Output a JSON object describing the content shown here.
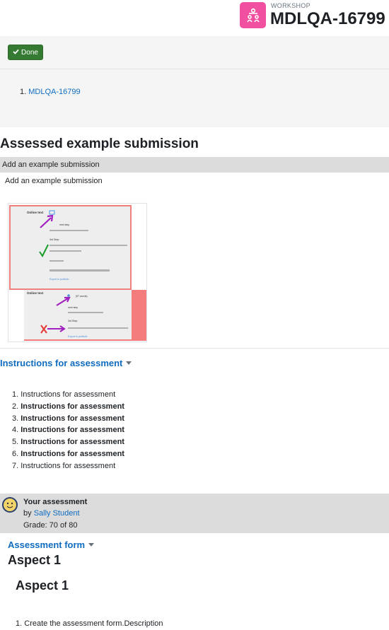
{
  "header": {
    "kicker": "WORKSHOP",
    "title": "MDLQA-16799",
    "icon": "workshop-people-icon",
    "icon_color": "#f14fa0"
  },
  "done_panel": {
    "done_label": "Done",
    "list_items": [
      {
        "num": "1.",
        "link": "MDLQA-16799"
      }
    ]
  },
  "assessed": {
    "title": "Assessed example submission",
    "bar_label": "Add an example submission",
    "line_label": "Add an example submission",
    "thumbnail": {
      "panel1_heading": "Online text",
      "panel1_lines": [
        "next step",
        "3rd Step:",
        "Export to portfolio"
      ],
      "panel2_heading": "Online text",
      "panel2_lines": [
        "(57 words)",
        "next step",
        "3rd Step:",
        "Export to portfolio"
      ]
    }
  },
  "instructions": {
    "heading": "Instructions for assessment",
    "items": [
      {
        "num": "1.",
        "text": "Instructions for assessment",
        "bold": false
      },
      {
        "num": "2.",
        "text": "Instructions for assessment",
        "bold": true
      },
      {
        "num": "3.",
        "text": "Instructions for assessment",
        "bold": true
      },
      {
        "num": "4.",
        "text": "Instructions for assessment",
        "bold": true
      },
      {
        "num": "5.",
        "text": "Instructions for assessment",
        "bold": true
      },
      {
        "num": "6.",
        "text": "Instructions for assessment",
        "bold": true
      },
      {
        "num": "7.",
        "text": "Instructions for assessment",
        "bold": false
      }
    ]
  },
  "your_assessment": {
    "title": "Your assessment",
    "by_prefix": "by",
    "reviewer": "Sally Student",
    "grade": "Grade: 70 of 80"
  },
  "assessment_form": {
    "heading": "Assessment form",
    "aspect_outer": "Aspect 1",
    "aspect_inner": "Aspect 1",
    "list_first": {
      "num": "1.",
      "text": "Create the assessment form.Description"
    }
  },
  "colors": {
    "link": "#0f6cbf",
    "success": "#357a32",
    "muted_bar": "#dcdcdc",
    "panel_bg": "#f5f5f6"
  }
}
